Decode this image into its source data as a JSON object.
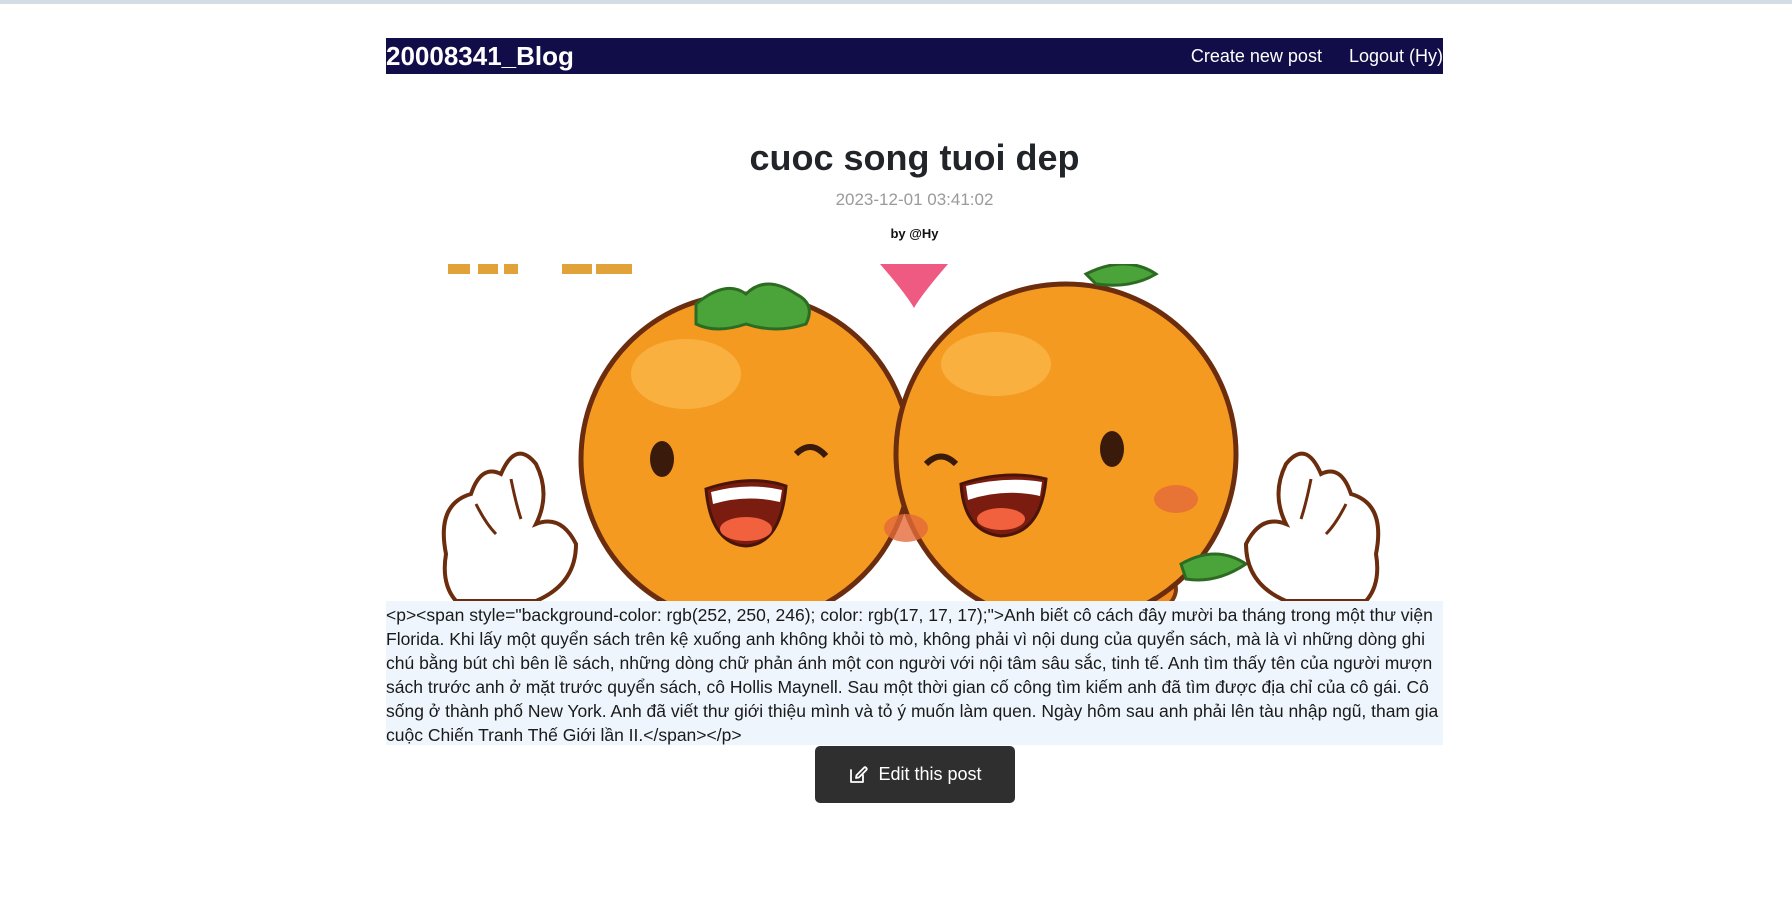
{
  "navbar": {
    "brand": "20008341_Blog",
    "create_label": "Create new post",
    "logout_label": "Logout (Hy)"
  },
  "post": {
    "title": "cuoc song tuoi dep",
    "date": "2023-12-01 03:41:02",
    "author": "by @Hy",
    "content": "<p><span style=\"background-color: rgb(252, 250, 246); color: rgb(17, 17, 17);\">Anh biết cô cách đây mười ba tháng trong một thư viện Florida. Khi lấy một quyển sách trên kệ xuống anh không khỏi tò mò, không phải vì nội dung của quyển sách, mà là vì những dòng ghi chú bằng bút chì bên lề sách, những dòng chữ phản ánh một con người với nội tâm sâu sắc, tinh tế. Anh tìm thấy tên của người mượn sách trước anh ở mặt trước quyển sách, cô Hollis Maynell. Sau một thời gian cố công tìm kiếm anh đã tìm được địa chỉ của cô gái. Cô sống ở thành phố New York. Anh đã viết thư giới thiệu mình và tỏ ý muốn làm quen. Ngày hôm sau anh phải lên tàu nhập ngũ, tham gia cuộc Chiến Tranh Thế Giới lần II.</span></p>"
  },
  "actions": {
    "edit_label": "Edit this post"
  },
  "icons": {
    "edit": "pencil-square-icon"
  },
  "colors": {
    "navbar_bg": "#110d49",
    "content_bg": "#eef5fd",
    "button_bg": "#2f2f2f",
    "date_color": "#9a9a9a"
  }
}
